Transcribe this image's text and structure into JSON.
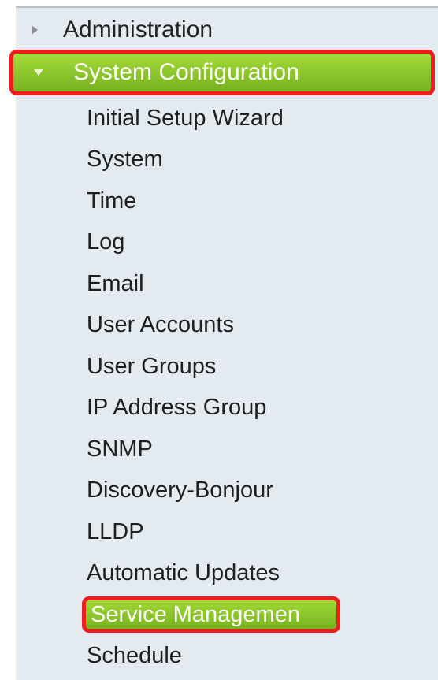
{
  "sections": {
    "administration": {
      "label": "Administration",
      "icon": "triangle-right-icon",
      "expanded": false
    },
    "system_configuration": {
      "label": "System Configuration",
      "icon": "triangle-down-icon",
      "expanded": true,
      "highlight_color": "#8bc72a",
      "outline_color": "#ee1e1e"
    }
  },
  "submenu": [
    {
      "label": "Initial Setup Wizard"
    },
    {
      "label": "System"
    },
    {
      "label": "Time"
    },
    {
      "label": "Log"
    },
    {
      "label": "Email"
    },
    {
      "label": "User Accounts"
    },
    {
      "label": "User Groups"
    },
    {
      "label": "IP Address Group"
    },
    {
      "label": "SNMP"
    },
    {
      "label": "Discovery-Bonjour"
    },
    {
      "label": "LLDP"
    },
    {
      "label": "Automatic Updates"
    },
    {
      "label": "Service Managemen",
      "selected": true
    },
    {
      "label": "Schedule"
    }
  ],
  "colors": {
    "panel_background": "#e3eaf0",
    "text": "#1f1f1f",
    "selected_text": "#ffffff"
  }
}
